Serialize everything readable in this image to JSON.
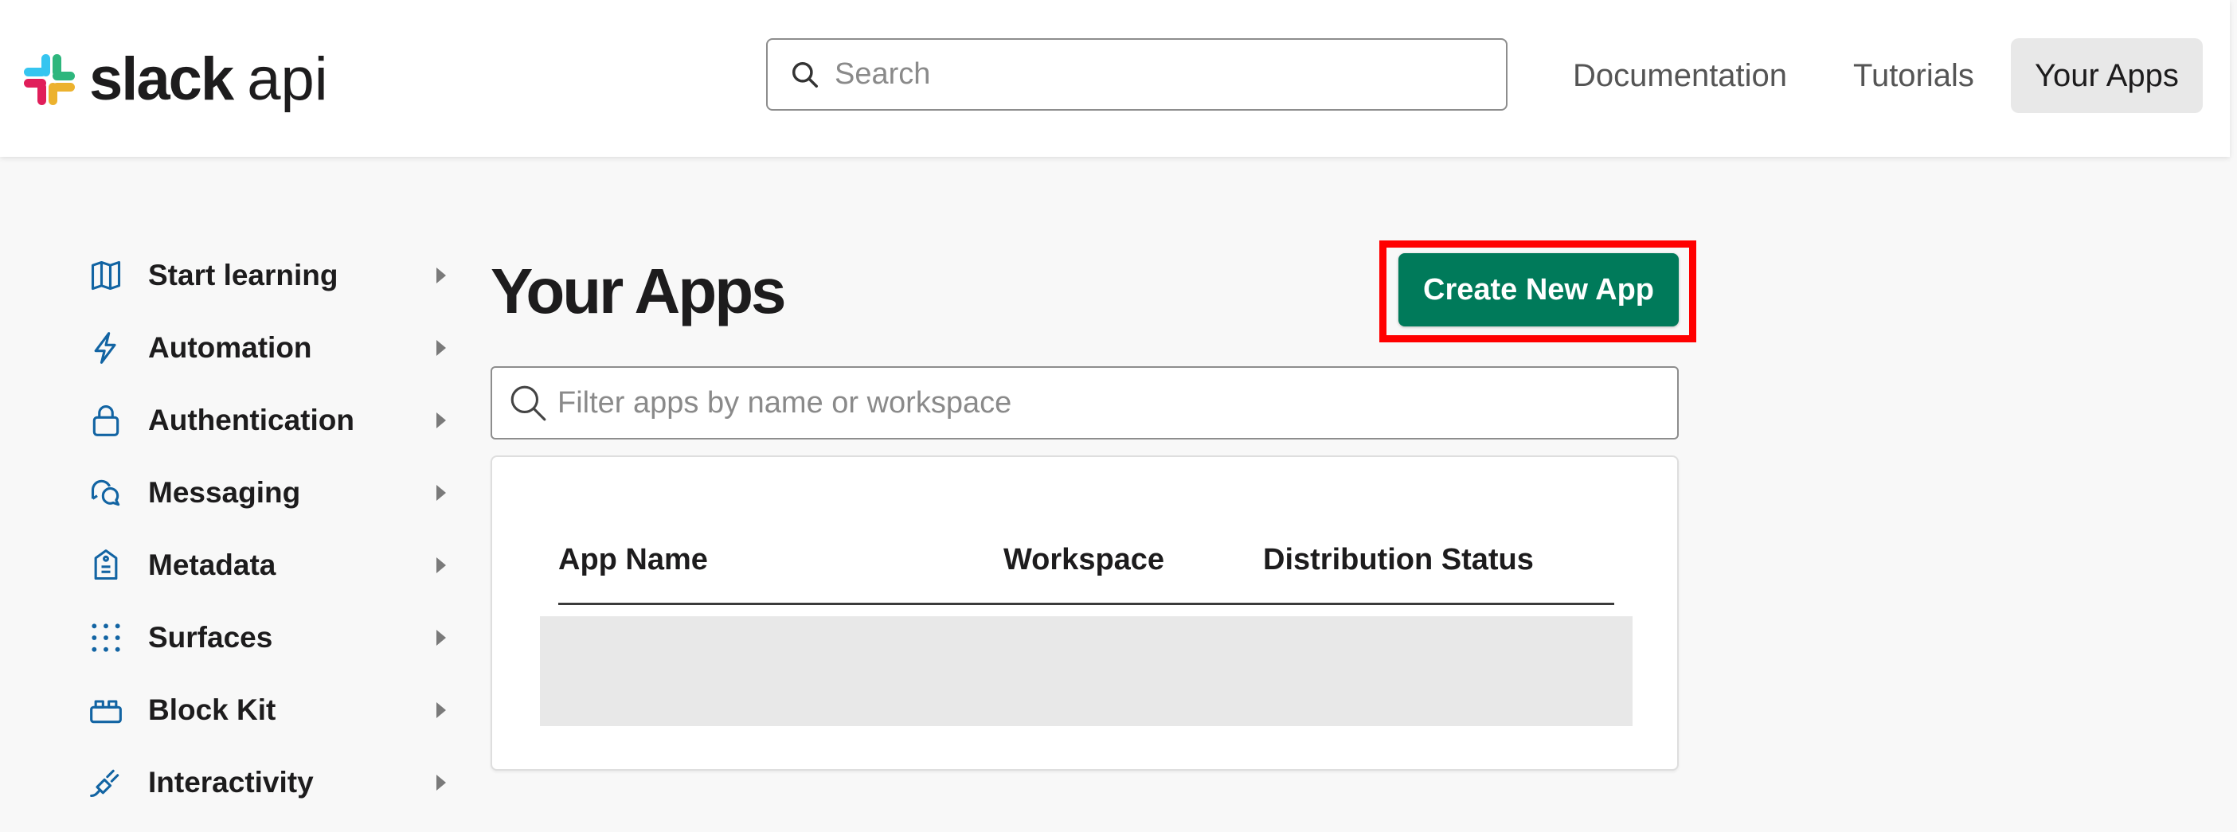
{
  "header": {
    "logo_word": "slack",
    "logo_suffix": "api",
    "search_placeholder": "Search",
    "nav": {
      "documentation": "Documentation",
      "tutorials": "Tutorials",
      "your_apps": "Your Apps"
    }
  },
  "sidebar": {
    "items": [
      {
        "label": "Start learning",
        "icon": "map-icon"
      },
      {
        "label": "Automation",
        "icon": "lightning-icon"
      },
      {
        "label": "Authentication",
        "icon": "lock-icon"
      },
      {
        "label": "Messaging",
        "icon": "chat-bubbles-icon"
      },
      {
        "label": "Metadata",
        "icon": "tag-icon"
      },
      {
        "label": "Surfaces",
        "icon": "grid-dots-icon"
      },
      {
        "label": "Block Kit",
        "icon": "blocks-icon"
      },
      {
        "label": "Interactivity",
        "icon": "plug-icon"
      }
    ]
  },
  "main": {
    "title": "Your Apps",
    "create_button": "Create New App",
    "filter_placeholder": "Filter apps by name or workspace",
    "table": {
      "columns": [
        "App Name",
        "Workspace",
        "Distribution Status"
      ]
    }
  },
  "colors": {
    "accent_green": "#007a5a",
    "highlight_red": "#ff0000",
    "sidebar_icon_blue": "#1264a3"
  }
}
